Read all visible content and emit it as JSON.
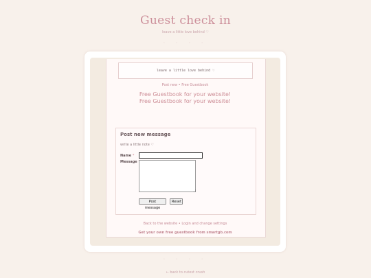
{
  "header": {
    "title": "Guest check in",
    "subtitle": "leave a little love behind ♡",
    "dots": "◦ ◦ ◦ ◦"
  },
  "guestbook": {
    "note": "leave a little love behind ♡",
    "post_new_label": "Post new",
    "separator": "•",
    "free_guestbook_label": "Free Guestbook",
    "promo_line1": "Free Guestbook for your website!",
    "promo_line2": "Free Guestbook for your website!"
  },
  "form": {
    "heading": "Post new message",
    "note": "write a little note ♡",
    "name_label": "Name",
    "message_label": "Message",
    "required_marker": "*",
    "name_value": "",
    "message_value": "",
    "post_button": "Post message",
    "reset_button": "Reset"
  },
  "footer": {
    "back_to_website": "Back to the website",
    "separator": "•",
    "login": "Login and change settings",
    "ad": "Get your own free guestbook from smartgb.com",
    "dots": "◦ ◦ ◦ ◦",
    "back_link": "← back to cutest crush"
  },
  "colors": {
    "background": "#f8f1eb",
    "accent": "#cd8e97",
    "card": "#ffffff",
    "panel": "#fff9f8"
  }
}
